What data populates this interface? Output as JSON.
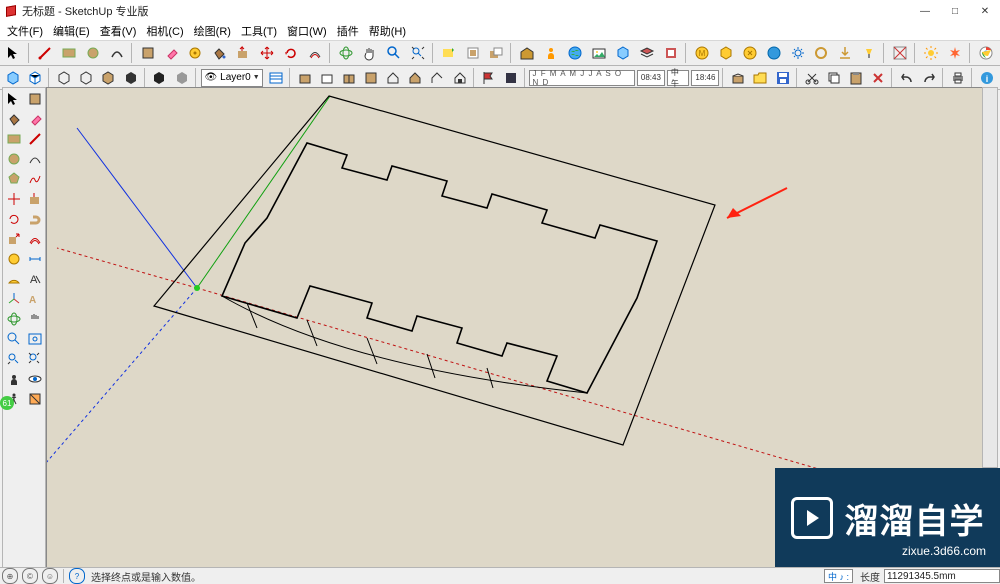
{
  "window": {
    "title": "无标题 - SketchUp 专业版",
    "min": "—",
    "max": "□",
    "close": "✕"
  },
  "menu": {
    "file": "文件(F)",
    "edit": "编辑(E)",
    "view": "查看(V)",
    "camera": "相机(C)",
    "draw": "绘图(R)",
    "tools": "工具(T)",
    "window": "窗口(W)",
    "plugins": "插件",
    "help": "帮助(H)"
  },
  "layer": {
    "eye": "👁",
    "name": "Layer0"
  },
  "time": {
    "months": "J F M A M J J A S O N D",
    "t1": "08:43",
    "mid": "中午",
    "t2": "18:46"
  },
  "status": {
    "hint": "选择终点或是输入数值。",
    "toggles": "中 ♪ :",
    "meas_label": "长度",
    "meas_value": "11291345.5mm"
  },
  "watermark": {
    "main": "溜溜自学",
    "sub": "zixue.3d66.com"
  },
  "badge": "61"
}
